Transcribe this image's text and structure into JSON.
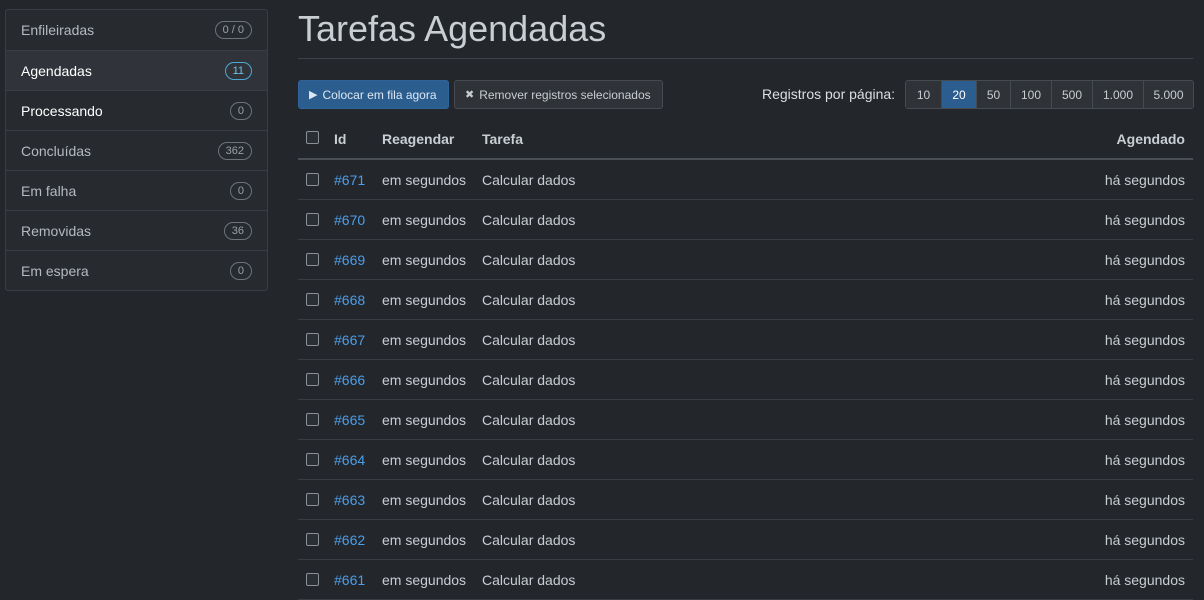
{
  "sidebar": {
    "items": [
      {
        "label": "Enfileiradas",
        "count": "0 / 0"
      },
      {
        "label": "Agendadas",
        "count": "11"
      },
      {
        "label": "Processando",
        "count": "0"
      },
      {
        "label": "Concluídas",
        "count": "362"
      },
      {
        "label": "Em falha",
        "count": "0"
      },
      {
        "label": "Removidas",
        "count": "36"
      },
      {
        "label": "Em espera",
        "count": "0"
      }
    ]
  },
  "page": {
    "title": "Tarefas Agendadas"
  },
  "toolbar": {
    "enqueue_label": "Colocar em fila agora",
    "remove_label": "Remover registros selecionados",
    "perpage_label": "Registros por página:",
    "perpage_options": [
      "10",
      "20",
      "50",
      "100",
      "500",
      "1.000",
      "5.000"
    ],
    "perpage_selected": "20"
  },
  "table": {
    "headers": {
      "id": "Id",
      "reschedule": "Reagendar",
      "task": "Tarefa",
      "scheduled": "Agendado"
    },
    "rows": [
      {
        "id": "#671",
        "reschedule": "em segundos",
        "task": "Calcular dados",
        "scheduled": "há segundos"
      },
      {
        "id": "#670",
        "reschedule": "em segundos",
        "task": "Calcular dados",
        "scheduled": "há segundos"
      },
      {
        "id": "#669",
        "reschedule": "em segundos",
        "task": "Calcular dados",
        "scheduled": "há segundos"
      },
      {
        "id": "#668",
        "reschedule": "em segundos",
        "task": "Calcular dados",
        "scheduled": "há segundos"
      },
      {
        "id": "#667",
        "reschedule": "em segundos",
        "task": "Calcular dados",
        "scheduled": "há segundos"
      },
      {
        "id": "#666",
        "reschedule": "em segundos",
        "task": "Calcular dados",
        "scheduled": "há segundos"
      },
      {
        "id": "#665",
        "reschedule": "em segundos",
        "task": "Calcular dados",
        "scheduled": "há segundos"
      },
      {
        "id": "#664",
        "reschedule": "em segundos",
        "task": "Calcular dados",
        "scheduled": "há segundos"
      },
      {
        "id": "#663",
        "reschedule": "em segundos",
        "task": "Calcular dados",
        "scheduled": "há segundos"
      },
      {
        "id": "#662",
        "reschedule": "em segundos",
        "task": "Calcular dados",
        "scheduled": "há segundos"
      },
      {
        "id": "#661",
        "reschedule": "em segundos",
        "task": "Calcular dados",
        "scheduled": "há segundos"
      }
    ]
  }
}
